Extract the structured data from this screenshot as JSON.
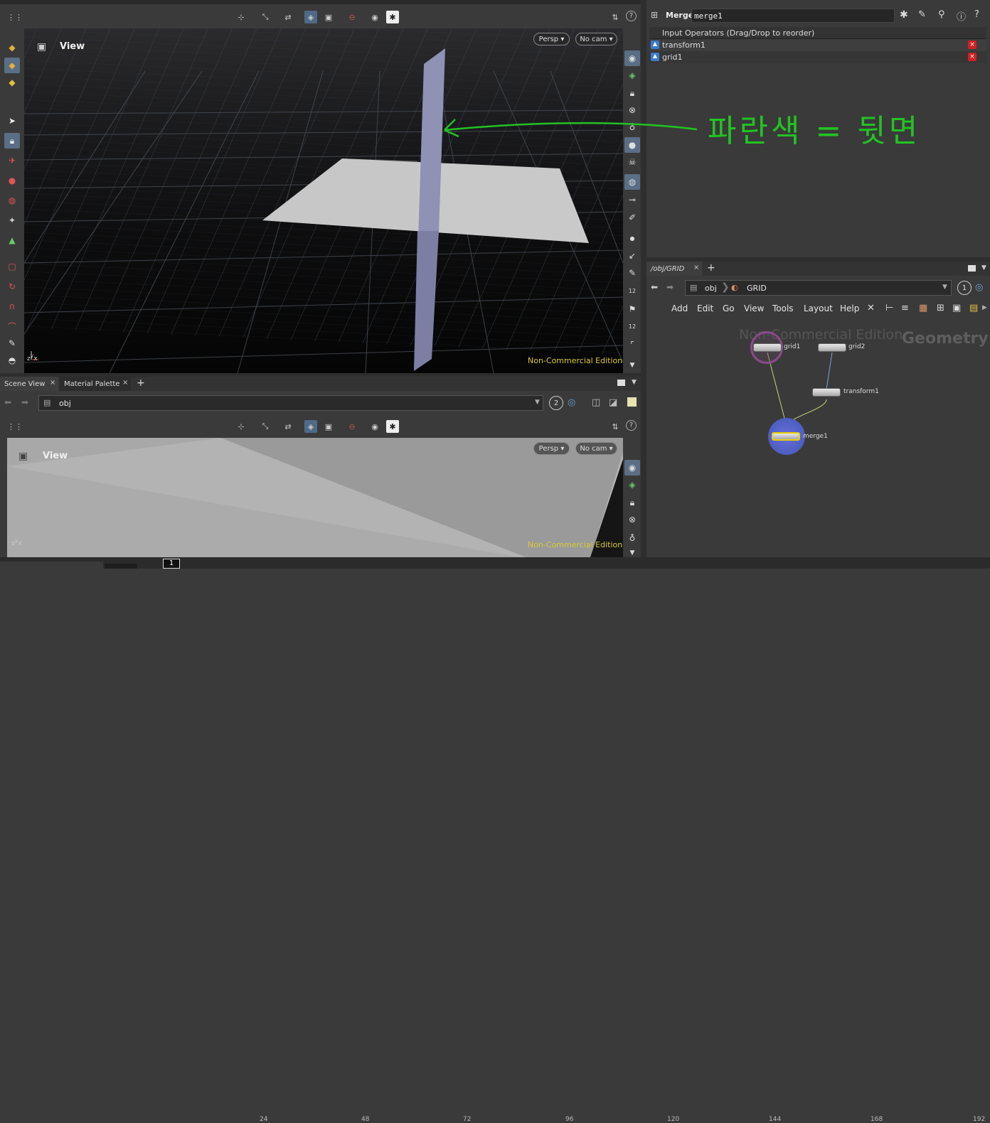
{
  "top_viewer": {
    "title": "View",
    "persp_label": "Persp ▾",
    "cam_label": "No cam ▾",
    "watermark": "Non-Commercial Edition"
  },
  "bottom_viewer": {
    "title": "View",
    "persp_label": "Persp ▾",
    "cam_label": "No cam ▾",
    "watermark": "Non-Commercial Edition"
  },
  "pane_tabs": {
    "scene_view": "Scene View",
    "material_palette": "Material Palette",
    "close": "×",
    "add": "+"
  },
  "path_bar": {
    "path": "obj",
    "badge": "2"
  },
  "annotation": {
    "text": "파란색 = 뒷면",
    "color": "#22c322"
  },
  "parameter_pane": {
    "node_type": "Merge",
    "node_name": "merge1",
    "list_header": "Input Operators (Drag/Drop to reorder)",
    "inputs": [
      "transform1",
      "grid1"
    ]
  },
  "network": {
    "tab_label": "/obj/GRID",
    "add_tab": "+",
    "breadcrumb_root": "obj",
    "breadcrumb_current": "GRID",
    "badge": "1",
    "menus": [
      "Add",
      "Edit",
      "Go",
      "View",
      "Tools",
      "Layout",
      "Help"
    ],
    "watermark": "Non-Commercial Edition",
    "context_label": "Geometry",
    "nodes": {
      "grid1": "grid1",
      "grid2": "grid2",
      "transform1": "transform1",
      "merge1": "merge1"
    }
  },
  "timeline": {
    "current_frame": "1",
    "ticks": [
      "24",
      "48",
      "72",
      "96",
      "120",
      "144",
      "168",
      "192"
    ]
  }
}
